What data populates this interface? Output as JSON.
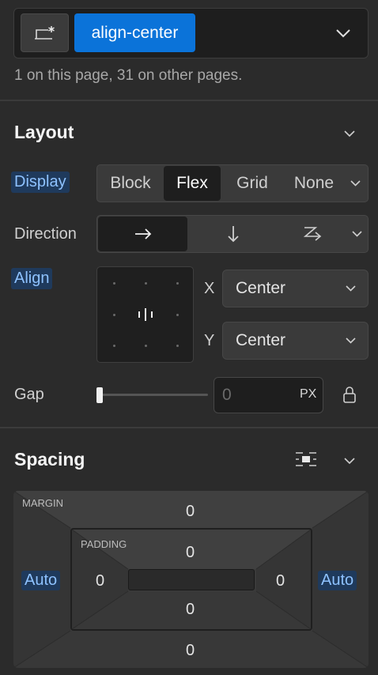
{
  "selector": {
    "icon": "class-selector-icon",
    "class_name": "align-center",
    "usage": "1 on this page, 31 on other pages."
  },
  "layout": {
    "title": "Layout",
    "display_label": "Display",
    "display_options": [
      "Block",
      "Flex",
      "Grid",
      "None"
    ],
    "display_selected": "Flex",
    "direction_label": "Direction",
    "direction_options": [
      "arrow-right-icon",
      "arrow-down-icon",
      "wrap-icon"
    ],
    "direction_selected": "arrow-right-icon",
    "align_label": "Align",
    "x_label": "X",
    "x_value": "Center",
    "y_label": "Y",
    "y_value": "Center",
    "gap_label": "Gap",
    "gap_value": "0",
    "gap_unit": "PX"
  },
  "spacing": {
    "title": "Spacing",
    "margin_caption": "MARGIN",
    "padding_caption": "PADDING",
    "margin": {
      "top": "0",
      "right": "Auto",
      "bottom": "0",
      "left": "Auto"
    },
    "padding": {
      "top": "0",
      "right": "0",
      "bottom": "0",
      "left": "0"
    }
  },
  "colors": {
    "accent": "#0b73d9",
    "set_highlight_bg": "#1f3a5c",
    "set_highlight_text": "#8ec2ff"
  }
}
